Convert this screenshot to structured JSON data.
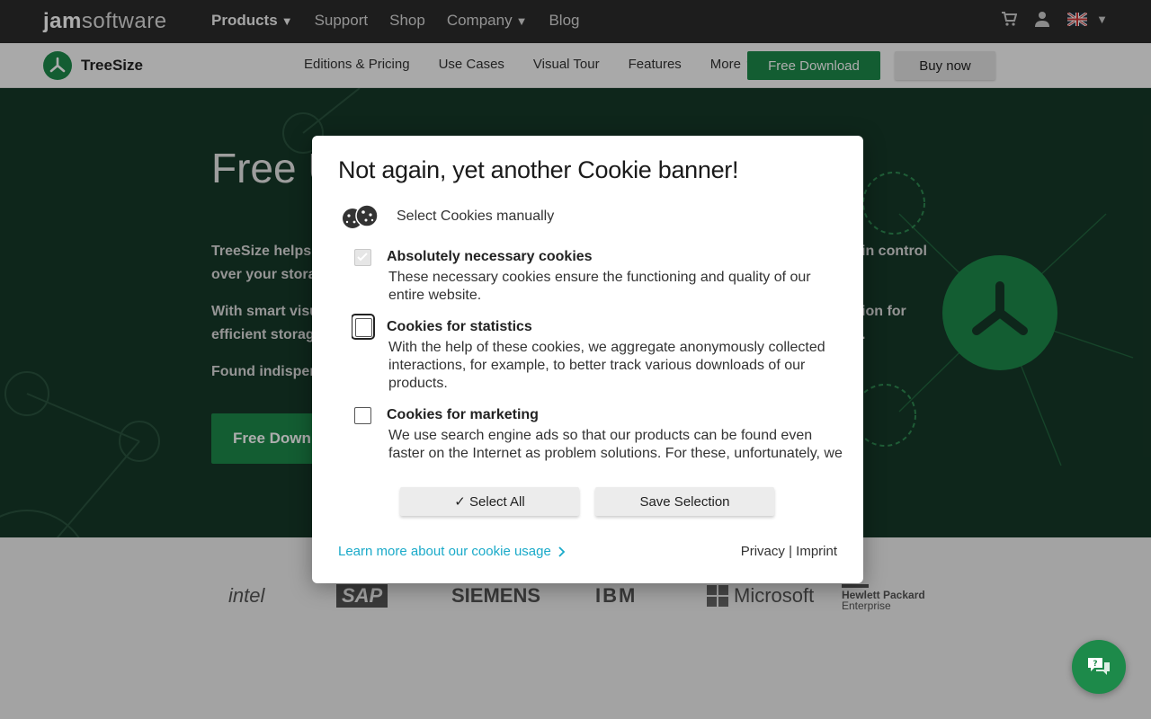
{
  "topbar": {
    "brand_bold": "jam",
    "brand_thin": "software",
    "nav": [
      {
        "label": "Products",
        "dropdown": true
      },
      {
        "label": "Support"
      },
      {
        "label": "Shop"
      },
      {
        "label": "Company",
        "dropdown": true
      },
      {
        "label": "Blog"
      }
    ],
    "icons": [
      "cart-icon",
      "user-icon",
      "uk-flag-icon"
    ]
  },
  "subbar": {
    "product_name": "TreeSize",
    "nav": [
      "Editions & Pricing",
      "Use Cases",
      "Visual Tour",
      "Features",
      "More"
    ],
    "free_download": "Free Download",
    "buy_now": "Buy now"
  },
  "hero": {
    "title": "Free U",
    "p1a": "TreeSize helps i",
    "p1b": "over your stora",
    "p2a": "With smart visu",
    "p2b": "efficient storag",
    "p3": "Found indispens",
    "right1": "in control",
    "right2": "ion for",
    "right3": ".",
    "button": "Free Downl"
  },
  "partners": [
    "intel",
    "SAP",
    "SIEMENS",
    "IBM",
    "Microsoft",
    "Hewlett Packard",
    "Enterprise"
  ],
  "cookie_modal": {
    "title": "Not again, yet another Cookie banner!",
    "manual_label": "Select Cookies manually",
    "items": [
      {
        "title": "Absolutely necessary cookies",
        "desc": "These necessary cookies ensure the functioning and quality of our entire website.",
        "checked": true,
        "disabled": true
      },
      {
        "title": "Cookies for statistics",
        "desc": "With the help of these cookies, we aggregate anonymously collected interactions, for example, to better track various downloads of our products.",
        "checked": false
      },
      {
        "title": "Cookies for marketing",
        "desc": "We use search engine ads so that our products can be found even faster on the Internet as problem solutions. For these, unfortunately, we",
        "checked": false
      }
    ],
    "select_all": "✓ Select All",
    "save_selection": "Save Selection",
    "learn_more": "Learn more about our cookie usage",
    "privacy": "Privacy",
    "separator": "|",
    "imprint": "Imprint"
  },
  "colors": {
    "brand_green": "#1d8a4a",
    "link_blue": "#1aaac9"
  }
}
